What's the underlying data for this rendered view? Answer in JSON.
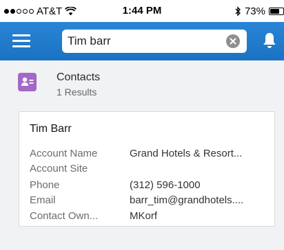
{
  "status_bar": {
    "carrier": "AT&T",
    "signal_bars_on": 2,
    "signal_bars_total": 5,
    "time": "1:44 PM",
    "battery_percent": "73%",
    "battery_level": 0.73
  },
  "header": {
    "search_value": "Tim barr"
  },
  "group": {
    "title": "Contacts",
    "count": "1 Results"
  },
  "record": {
    "name": "Tim Barr",
    "fields": [
      {
        "label": "Account Name",
        "value": "Grand Hotels & Resort..."
      },
      {
        "label": "Account Site",
        "value": ""
      },
      {
        "label": "Phone",
        "value": "(312) 596-1000"
      },
      {
        "label": "Email",
        "value": "barr_tim@grandhotels...."
      },
      {
        "label": "Contact Own...",
        "value": "MKorf"
      }
    ]
  },
  "colors": {
    "header_blue": "#1f7bcd",
    "contacts_purple": "#a468c6",
    "background": "#f1f2f4"
  }
}
